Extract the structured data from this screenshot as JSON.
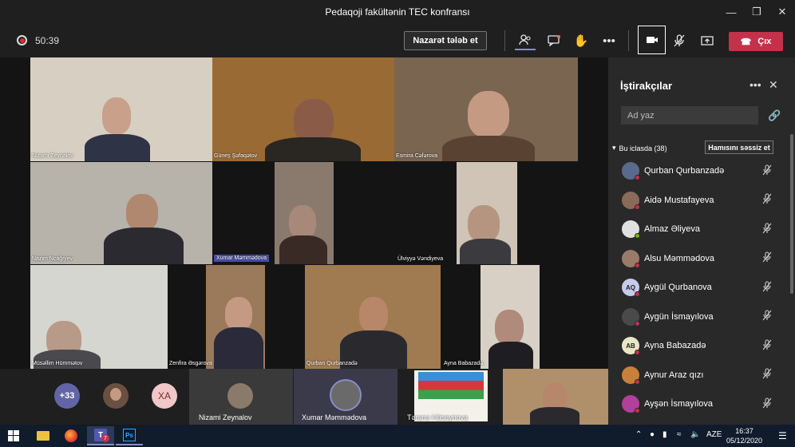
{
  "window": {
    "title": "Pedaqoji fakültənin TEC konfransı"
  },
  "toolbar": {
    "timer": "50:39",
    "request_control_label": "Nazarət tələb et",
    "leave_label": "Çıx"
  },
  "stage": {
    "tiles": [
      {
        "name": "Nizami Zeynalov"
      },
      {
        "name": "Güneş Şəfaqətov"
      },
      {
        "name": "Esmira Cəfərova"
      },
      {
        "name": "Nazim Ncağıyev"
      },
      {
        "name": "Xumar Məmmədova"
      },
      {
        "name": "Ülviyyə Vəndiyeva"
      },
      {
        "name": "Müsəllim Hümmətov"
      },
      {
        "name": "Zenfira Əsgərova"
      },
      {
        "name": "Qurban Qurbanzadə"
      },
      {
        "name": "Ayna Babazadə"
      }
    ]
  },
  "bottom": {
    "overflow_count": "+33",
    "avatar_initials": "XA",
    "tile_names": [
      "Nizami Zeynalov",
      "Xumar Məmmədova",
      "Təranə Hüseynova"
    ]
  },
  "panel": {
    "title": "İştirakçılar",
    "search_placeholder": "Ad yaz",
    "section_label": "Bu iclasda (38)",
    "mute_all_label": "Hamısını səssiz et",
    "participants": [
      {
        "name": "Qurban Qurbanzadə",
        "initials": "",
        "status": "#c4314b",
        "avatar_color": "#5a6a8a"
      },
      {
        "name": "Aidə Mustafayeva",
        "initials": "",
        "status": "#c4314b",
        "avatar_color": "#8a6a5a"
      },
      {
        "name": "Almaz Əliyeva",
        "initials": "",
        "status": "#6bb700",
        "avatar_color": "#e0e0e0"
      },
      {
        "name": "Alsu Məmmədova",
        "initials": "",
        "status": "#c4314b",
        "avatar_color": "#9a7a6a"
      },
      {
        "name": "Aygül Qurbanova",
        "initials": "AQ",
        "status": "#c4314b",
        "avatar_color": "#c5cbe9"
      },
      {
        "name": "Aygün İsmayılova",
        "initials": "",
        "status": "#c4314b",
        "avatar_color": "#4a4a4a"
      },
      {
        "name": "Ayna Babazadə",
        "initials": "AB",
        "status": "#c4314b",
        "avatar_color": "#e9e6c5"
      },
      {
        "name": "Aynur Araz qızı",
        "initials": "",
        "status": "#c4314b",
        "avatar_color": "#c8803a"
      },
      {
        "name": "Ayşən İsmayılova",
        "initials": "",
        "status": "#c4314b",
        "avatar_color": "#b0409a"
      }
    ]
  },
  "taskbar": {
    "teams_badge": "7",
    "ps_label": "Ps",
    "lang": "AZE",
    "time": "16:37",
    "date": "05/12/2020"
  }
}
